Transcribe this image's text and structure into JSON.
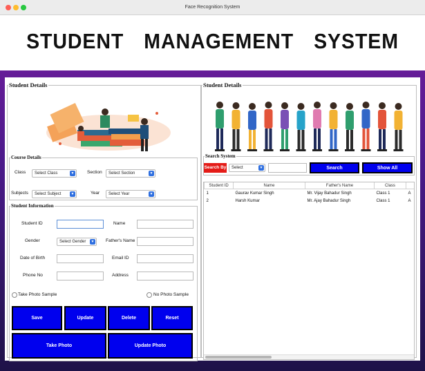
{
  "window": {
    "title": "Face Recognition System"
  },
  "header": {
    "title": "STUDENT   MANAGEMENT   SYSTEM"
  },
  "left": {
    "title": "Student Details",
    "course": {
      "title": "Course Details",
      "class_label": "Class",
      "class_value": "Select Class",
      "section_label": "Section",
      "section_value": "Select Section",
      "subjects_label": "Subjects",
      "subjects_value": "Select Subject",
      "year_label": "Year",
      "year_value": "Select Year"
    },
    "info": {
      "title": "Student Information",
      "student_id_label": "Student ID",
      "name_label": "Name",
      "gender_label": "Gender",
      "gender_value": "Select Gender",
      "father_label": "Father's Name",
      "dob_label": "Date of Birth",
      "email_label": "Email ID",
      "phone_label": "Phone No",
      "address_label": "Address",
      "take_sample_label": "Take Photo Sample",
      "no_sample_label": "No Photo Sample"
    },
    "buttons": {
      "save": "Save",
      "update": "Update",
      "delete": "Delete",
      "reset": "Reset",
      "take_photo": "Take Photo",
      "update_photo": "Update Photo"
    }
  },
  "right": {
    "title": "Student Details",
    "search": {
      "title": "Search System",
      "search_by": "Search By",
      "select_value": "Select",
      "search_button": "Search",
      "show_all_button": "Show All"
    },
    "table": {
      "headers": [
        "Student ID",
        "Name",
        "Father's Name",
        "Class",
        ""
      ],
      "rows": [
        [
          "1",
          "Gaurav Kumar Singh",
          "Mr. Vijay Bahadur Singh",
          "Class 1",
          "A"
        ],
        [
          "2",
          "Harsh Kumar",
          "Mr. Ajay Bahadur Singh",
          "Class 1",
          "A"
        ]
      ]
    }
  },
  "colors": {
    "button": "#0000ee",
    "search_by": "#e41b17",
    "header_bg": "#ffffff"
  }
}
